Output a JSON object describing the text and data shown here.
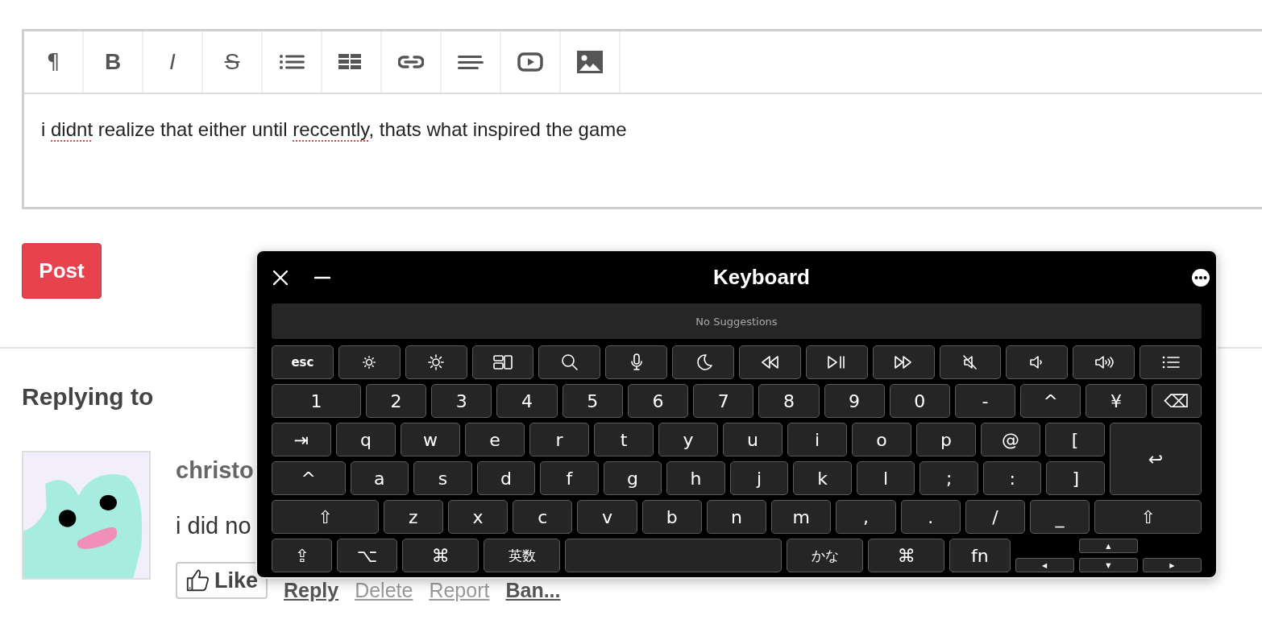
{
  "editor": {
    "toolbar": [
      {
        "kind": "paragraph",
        "label": "¶"
      },
      {
        "kind": "bold",
        "label": "B"
      },
      {
        "kind": "italic",
        "label": "I"
      },
      {
        "kind": "strike",
        "label": "S"
      },
      {
        "kind": "list"
      },
      {
        "kind": "table"
      },
      {
        "kind": "link"
      },
      {
        "kind": "align"
      },
      {
        "kind": "video"
      },
      {
        "kind": "image"
      }
    ],
    "content": [
      {
        "text": "i ",
        "misspelled": false
      },
      {
        "text": "didnt",
        "misspelled": true
      },
      {
        "text": " realize that either until ",
        "misspelled": false
      },
      {
        "text": "reccently",
        "misspelled": true
      },
      {
        "text": ", thats what inspired the game",
        "misspelled": false
      }
    ]
  },
  "post_button": "Post",
  "replying_to": {
    "heading": "Replying to",
    "author": "christo",
    "comment": "i did no",
    "like_button": "Like",
    "actions": [
      {
        "label": "Reply",
        "muted": false
      },
      {
        "label": "Delete",
        "muted": true
      },
      {
        "label": "Report",
        "muted": true
      },
      {
        "label": "Ban...",
        "muted": false
      }
    ]
  },
  "keyboard": {
    "title": "Keyboard",
    "suggestions": "No Suggestions",
    "rows": [
      [
        {
          "kind": "text",
          "label": "esc"
        },
        {
          "kind": "icon"
        },
        {
          "kind": "icon"
        },
        {
          "kind": "icon"
        },
        {
          "kind": "icon"
        },
        {
          "kind": "icon"
        },
        {
          "kind": "icon"
        },
        {
          "kind": "icon"
        },
        {
          "kind": "icon"
        },
        {
          "kind": "icon"
        },
        {
          "kind": "icon"
        },
        {
          "kind": "icon"
        },
        {
          "kind": "icon"
        },
        {
          "kind": "icon"
        }
      ],
      [
        {
          "kind": "text",
          "label": "1"
        },
        {
          "kind": "text",
          "label": "2"
        },
        {
          "kind": "text",
          "label": "3"
        },
        {
          "kind": "text",
          "label": "4"
        },
        {
          "kind": "text",
          "label": "5"
        },
        {
          "kind": "text",
          "label": "6"
        },
        {
          "kind": "text",
          "label": "7"
        },
        {
          "kind": "text",
          "label": "8"
        },
        {
          "kind": "text",
          "label": "9"
        },
        {
          "kind": "text",
          "label": "0"
        },
        {
          "kind": "text",
          "label": "-"
        },
        {
          "kind": "text",
          "label": "^"
        },
        {
          "kind": "text",
          "label": "¥"
        },
        {
          "kind": "text",
          "label": "⌫"
        }
      ],
      [
        {
          "kind": "text",
          "label": "⇥"
        },
        {
          "kind": "text",
          "label": "q"
        },
        {
          "kind": "text",
          "label": "w"
        },
        {
          "kind": "text",
          "label": "e"
        },
        {
          "kind": "text",
          "label": "r"
        },
        {
          "kind": "text",
          "label": "t"
        },
        {
          "kind": "text",
          "label": "y"
        },
        {
          "kind": "text",
          "label": "u"
        },
        {
          "kind": "text",
          "label": "i"
        },
        {
          "kind": "text",
          "label": "o"
        },
        {
          "kind": "text",
          "label": "p"
        },
        {
          "kind": "text",
          "label": "@"
        },
        {
          "kind": "text",
          "label": "["
        },
        {
          "kind": "return",
          "label": "↩"
        }
      ],
      [
        {
          "kind": "text",
          "label": "^"
        },
        {
          "kind": "text",
          "label": "a"
        },
        {
          "kind": "text",
          "label": "s"
        },
        {
          "kind": "text",
          "label": "d"
        },
        {
          "kind": "text",
          "label": "f"
        },
        {
          "kind": "text",
          "label": "g"
        },
        {
          "kind": "text",
          "label": "h"
        },
        {
          "kind": "text",
          "label": "j"
        },
        {
          "kind": "text",
          "label": "k"
        },
        {
          "kind": "text",
          "label": "l"
        },
        {
          "kind": "text",
          "label": ";"
        },
        {
          "kind": "text",
          "label": ":"
        },
        {
          "kind": "text",
          "label": "]"
        }
      ],
      [
        {
          "kind": "text",
          "label": "⇧"
        },
        {
          "kind": "text",
          "label": "z"
        },
        {
          "kind": "text",
          "label": "x"
        },
        {
          "kind": "text",
          "label": "c"
        },
        {
          "kind": "text",
          "label": "v"
        },
        {
          "kind": "text",
          "label": "b"
        },
        {
          "kind": "text",
          "label": "n"
        },
        {
          "kind": "text",
          "label": "m"
        },
        {
          "kind": "text",
          "label": ","
        },
        {
          "kind": "text",
          "label": "."
        },
        {
          "kind": "text",
          "label": "/"
        },
        {
          "kind": "text",
          "label": "_"
        },
        {
          "kind": "text",
          "label": "⇧"
        }
      ],
      [
        {
          "kind": "text",
          "label": "⇪"
        },
        {
          "kind": "text",
          "label": "⌥"
        },
        {
          "kind": "text",
          "label": "⌘"
        },
        {
          "kind": "text",
          "label": "英数"
        },
        {
          "kind": "space"
        },
        {
          "kind": "text",
          "label": "かな"
        },
        {
          "kind": "text",
          "label": "⌘"
        },
        {
          "kind": "text",
          "label": "fn"
        }
      ]
    ],
    "arrow_keys": [
      "▲",
      "◀",
      "▼",
      "▶"
    ]
  }
}
